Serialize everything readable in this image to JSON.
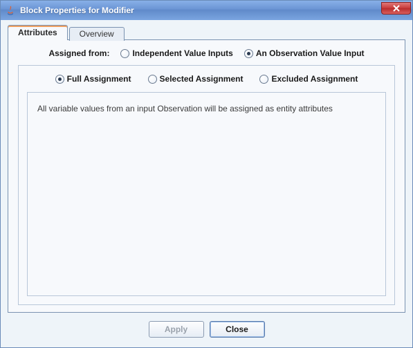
{
  "window": {
    "title": "Block Properties for Modifier"
  },
  "tabs": {
    "attributes": "Attributes",
    "overview": "Overview"
  },
  "assigned_from": {
    "label": "Assigned from:",
    "options": {
      "independent": "Independent Value Inputs",
      "observation": "An Observation Value Input"
    }
  },
  "assignment_mode": {
    "full": "Full Assignment",
    "selected": "Selected Assignment",
    "excluded": "Excluded Assignment"
  },
  "description": "All variable values from an input Observation will be assigned as entity attributes",
  "buttons": {
    "apply": "Apply",
    "close": "Close"
  }
}
